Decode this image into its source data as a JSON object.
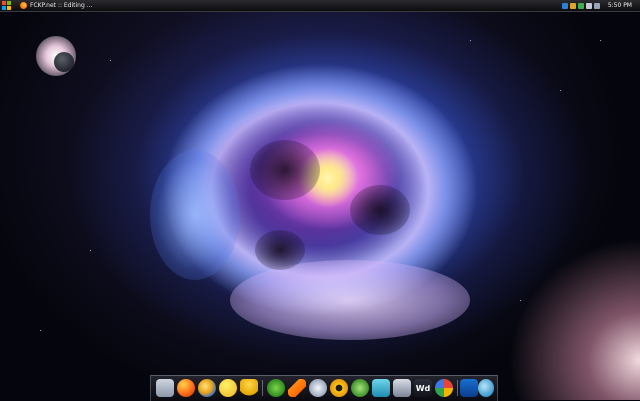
{
  "taskbar": {
    "task_title": "FCKP.net :: Editing ...",
    "clock": "5:50 PM",
    "tray_icons": [
      "back-arrow-icon",
      "folder-icon",
      "network-icon",
      "volume-icon",
      "power-icon"
    ]
  },
  "dock": {
    "items": [
      {
        "icon": "recycle-bin-icon"
      },
      {
        "icon": "firefox-browser-icon"
      },
      {
        "icon": "internet-explorer-icon"
      },
      {
        "icon": "yahoo-messenger-icon"
      },
      {
        "icon": "aim-messenger-icon"
      },
      {
        "icon": "windows-media-center-icon"
      },
      {
        "icon": "vlc-player-icon"
      },
      {
        "icon": "media-player-icon"
      },
      {
        "icon": "radiation-app-icon"
      },
      {
        "icon": "utorrent-icon"
      },
      {
        "icon": "skype-icon"
      },
      {
        "icon": "control-panel-icon"
      },
      {
        "icon": "word-app-icon",
        "label": "Wd"
      },
      {
        "icon": "picasa-icon"
      },
      {
        "icon": "desktop-monitor-icon"
      },
      {
        "icon": "recycle-swirl-icon"
      }
    ]
  },
  "colors": {
    "taskbar": "#1a1a1e",
    "nebula_core": "#ffe98a",
    "nebula_magenta": "#e040c8",
    "nebula_blue": "#4a70e0"
  }
}
